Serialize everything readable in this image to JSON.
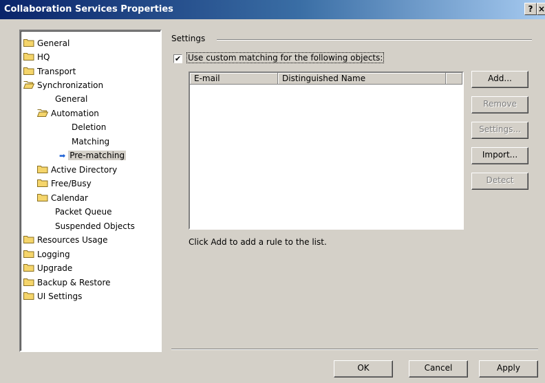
{
  "window": {
    "title": "Collaboration Services Properties",
    "help_label": "?",
    "close_label": "×"
  },
  "tree": [
    {
      "label": "General",
      "folder": true
    },
    {
      "label": "HQ",
      "folder": true
    },
    {
      "label": "Transport",
      "folder": true
    },
    {
      "label": "Synchronization",
      "folder": true,
      "open": true
    },
    {
      "label": "General",
      "folder": false
    },
    {
      "label": "Automation",
      "folder": true,
      "open": true
    },
    {
      "label": "Deletion",
      "folder": false
    },
    {
      "label": "Matching",
      "folder": false
    },
    {
      "label": "Pre-matching",
      "folder": false,
      "selected": true
    },
    {
      "label": "Active Directory",
      "folder": true
    },
    {
      "label": "Free/Busy",
      "folder": true
    },
    {
      "label": "Calendar",
      "folder": true
    },
    {
      "label": "Packet Queue",
      "folder": false
    },
    {
      "label": "Suspended Objects",
      "folder": false
    },
    {
      "label": "Resources Usage",
      "folder": true
    },
    {
      "label": "Logging",
      "folder": true
    },
    {
      "label": "Upgrade",
      "folder": true
    },
    {
      "label": "Backup & Restore",
      "folder": true
    },
    {
      "label": "UI Settings",
      "folder": true
    }
  ],
  "settings": {
    "group_label": "Settings",
    "checkbox_checked": true,
    "checkbox_mark": "✔",
    "checkbox_label": "Use custom matching for the following objects:",
    "columns": [
      "E-mail",
      "Distinguished Name"
    ],
    "hint": "Click Add to add a rule to the list."
  },
  "side_buttons": {
    "add": "Add...",
    "remove": "Remove",
    "settings": "Settings...",
    "import": "Import...",
    "detect": "Detect"
  },
  "footer": {
    "ok": "OK",
    "cancel": "Cancel",
    "apply": "Apply"
  },
  "colors": {
    "title_start": "#0a246a",
    "title_end": "#a6caf0",
    "face": "#d4d0c8",
    "folder": "#f5d56b",
    "selection_arrow": "#1a5fd6"
  }
}
